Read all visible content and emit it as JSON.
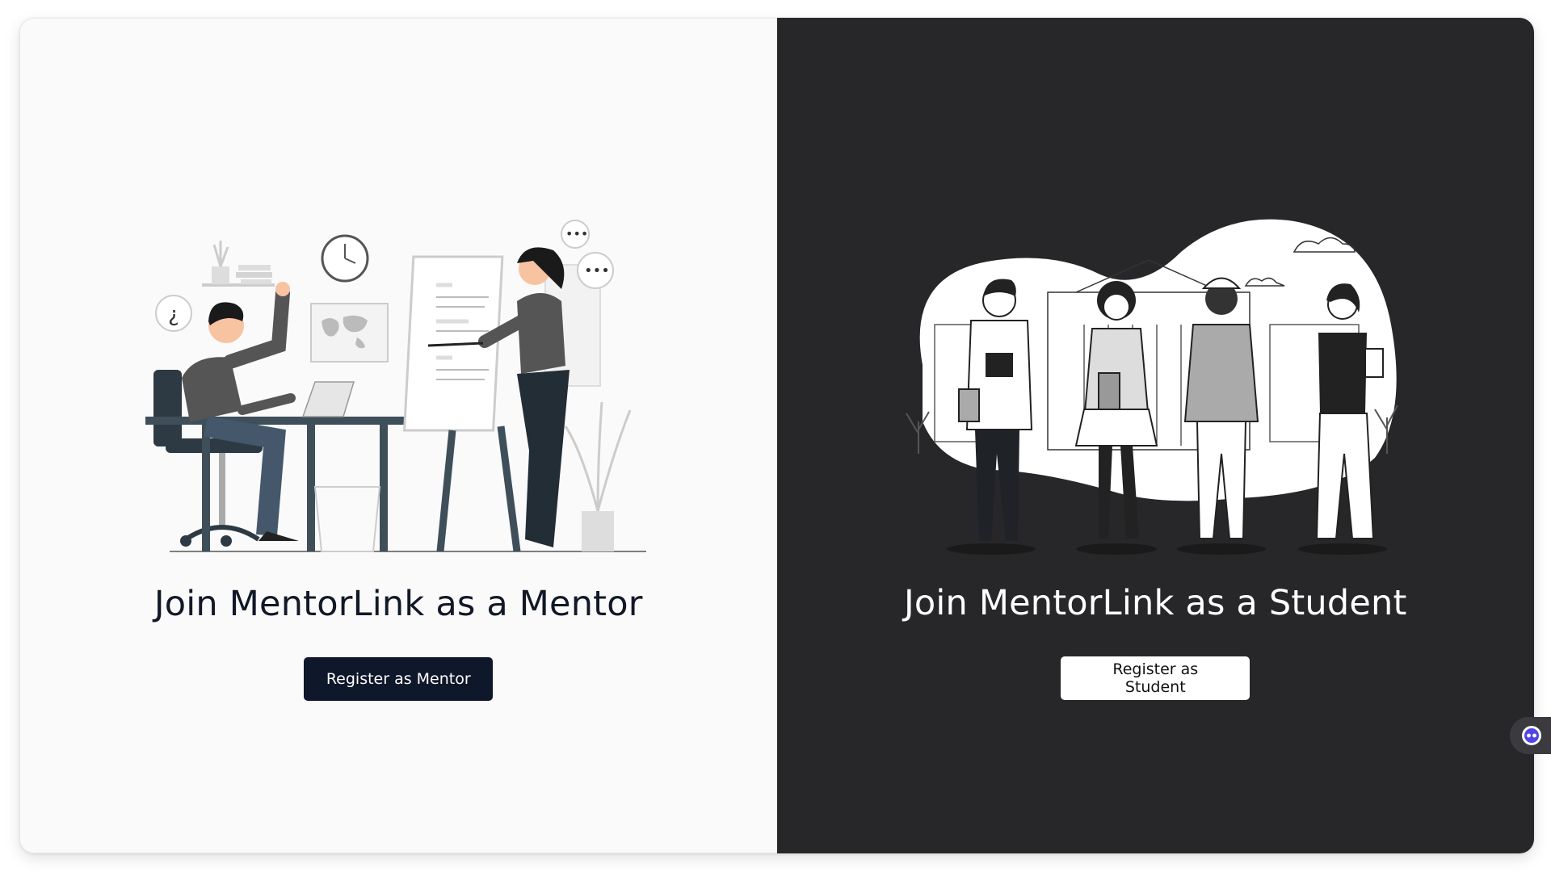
{
  "mentor": {
    "title": "Join MentorLink as a Mentor",
    "button_label": "Register as Mentor",
    "illustration_icon": "mentor-presentation-illustration"
  },
  "student": {
    "title": "Join MentorLink as a Student",
    "button_label": "Register as Student",
    "illustration_icon": "students-group-illustration"
  },
  "widget": {
    "icon": "chat-bot-icon"
  },
  "colors": {
    "left_bg": "#fafafa",
    "right_bg": "#27272a",
    "mentor_button_bg": "#0f172a",
    "student_button_bg": "#ffffff",
    "widget_accent": "#4f46e5"
  }
}
